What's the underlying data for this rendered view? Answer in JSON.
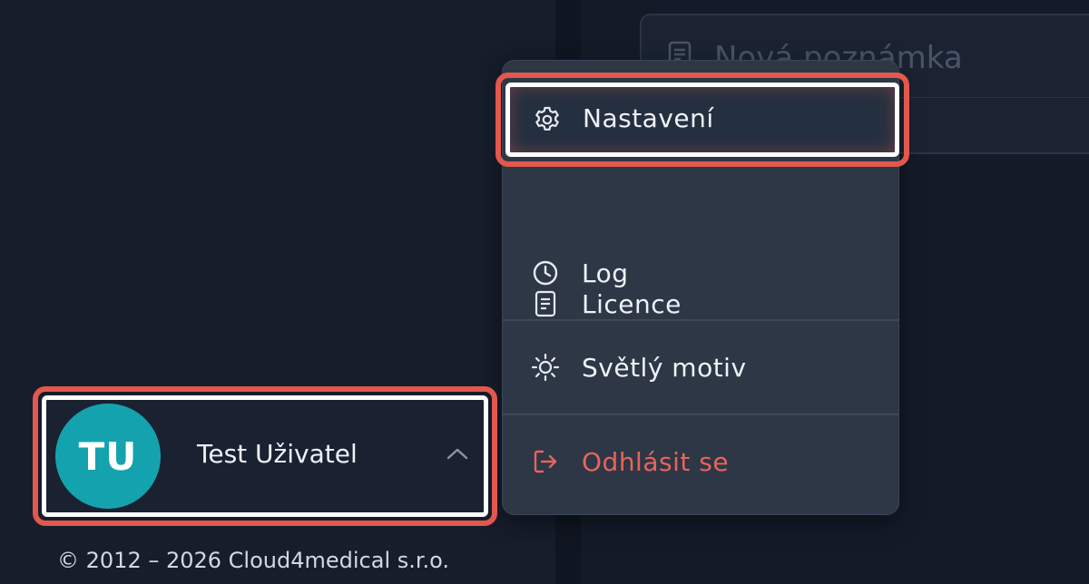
{
  "note": {
    "placeholder": "Nová poznámka"
  },
  "menu": {
    "items": [
      {
        "label": "Nastavení",
        "icon": "gear-icon"
      },
      {
        "label": "Licence",
        "icon": "document-icon"
      },
      {
        "label": "Log",
        "icon": "clock-icon"
      },
      {
        "label": "Světlý motiv",
        "icon": "sun-icon"
      },
      {
        "label": "Odhlásit se",
        "icon": "logout-icon"
      }
    ]
  },
  "user": {
    "initials": "TU",
    "name": "Test Uživatel"
  },
  "footer": {
    "copyright": "© 2012 – 2026 Cloud4medical s.r.o."
  },
  "colors": {
    "accent_teal": "#14a3ae",
    "highlight_red": "#e2584d",
    "logout_red": "#e8645b",
    "menu_bg": "#2d3746",
    "sidebar_bg": "#161d2b"
  }
}
